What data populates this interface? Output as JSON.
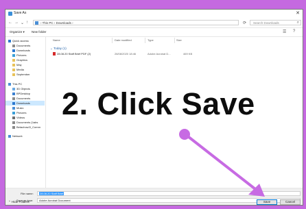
{
  "window": {
    "title": "Save As",
    "close_glyph": "✕"
  },
  "nav": {
    "back": "←",
    "forward": "→",
    "up_history": "⌄",
    "up": "↑",
    "breadcrumb": "›  This PC  ›  Downloads  ›",
    "refresh": "⟳",
    "search_placeholder": "Search Downloads"
  },
  "toolbar": {
    "organize": "Organize ▾",
    "new_folder": "New folder"
  },
  "sidebar": {
    "items": [
      {
        "label": "Quick access",
        "icon": "star-icon"
      },
      {
        "label": "Documents",
        "icon": "document-icon"
      },
      {
        "label": "Downloads",
        "icon": "download-icon"
      },
      {
        "label": "Pictures",
        "icon": "picture-icon"
      },
      {
        "label": "Graphics",
        "icon": "folder-icon"
      },
      {
        "label": "May",
        "icon": "folder-icon"
      },
      {
        "label": "Media",
        "icon": "folder-icon"
      },
      {
        "label": "September",
        "icon": "folder-icon"
      },
      {
        "label": "This PC",
        "icon": "pc-icon"
      },
      {
        "label": "3D Objects",
        "icon": "cube-icon"
      },
      {
        "label": "BPDesktop",
        "icon": "desktop-icon"
      },
      {
        "label": "Documents",
        "icon": "document-icon"
      },
      {
        "label": "Downloads",
        "icon": "download-icon"
      },
      {
        "label": "Music",
        "icon": "music-icon"
      },
      {
        "label": "Pictures",
        "icon": "picture-icon"
      },
      {
        "label": "Videos",
        "icon": "video-icon"
      },
      {
        "label": "Documents (\\\\abs",
        "icon": "drive-icon"
      },
      {
        "label": "Betachow2I_Comm",
        "icon": "drive-icon"
      },
      {
        "label": "Network",
        "icon": "network-icon"
      }
    ]
  },
  "columns": {
    "name": "Name",
    "date": "Date modified",
    "type": "Type",
    "size": "Size"
  },
  "group": {
    "label": "⌄ Today (1)"
  },
  "file": {
    "name": "28.08.20 Staff Brief PDF (2)",
    "date": "28/08/2020 18:46",
    "type": "Adobe Acrobat D...",
    "size": "469 KB"
  },
  "save": {
    "filename_label": "File name:",
    "filename_value": "28.08.20 Staff Brief",
    "type_label": "Save as type:",
    "type_value": "Adobe Acrobat Document",
    "hide_folders": "⌃ Hide Folders",
    "save_btn": "Save",
    "cancel_btn": "Cancel"
  },
  "overlay": {
    "instruction": "2. Click Save"
  },
  "colors": {
    "background": "#c569e0",
    "arrow": "#c76be3",
    "accent": "#0078d7"
  }
}
